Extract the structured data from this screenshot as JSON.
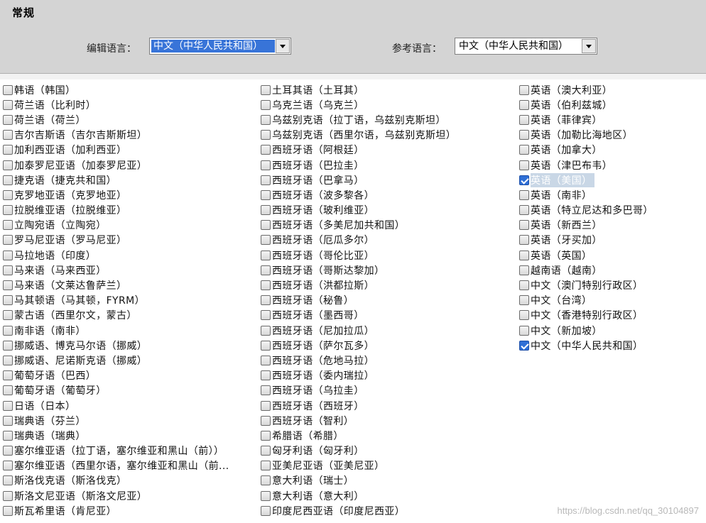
{
  "section": {
    "title": "常规"
  },
  "edit_lang": {
    "label": "编辑语言：",
    "value": "中文（中华人民共和国）"
  },
  "ref_lang": {
    "label": "参考语言：",
    "value": "中文（中华人民共和国）"
  },
  "columns": [
    [
      {
        "label": "韩语（韩国）",
        "checked": false
      },
      {
        "label": "荷兰语（比利时）",
        "checked": false
      },
      {
        "label": "荷兰语（荷兰）",
        "checked": false
      },
      {
        "label": "吉尔吉斯语（吉尔吉斯斯坦）",
        "checked": false
      },
      {
        "label": "加利西亚语（加利西亚）",
        "checked": false
      },
      {
        "label": "加泰罗尼亚语（加泰罗尼亚）",
        "checked": false
      },
      {
        "label": "捷克语（捷克共和国）",
        "checked": false
      },
      {
        "label": "克罗地亚语（克罗地亚）",
        "checked": false
      },
      {
        "label": "拉脱维亚语（拉脱维亚）",
        "checked": false
      },
      {
        "label": "立陶宛语（立陶宛）",
        "checked": false
      },
      {
        "label": "罗马尼亚语（罗马尼亚）",
        "checked": false
      },
      {
        "label": "马拉地语（印度）",
        "checked": false
      },
      {
        "label": "马来语（马来西亚）",
        "checked": false
      },
      {
        "label": "马来语（文莱达鲁萨兰）",
        "checked": false
      },
      {
        "label": "马其顿语（马其顿，FYRM）",
        "checked": false
      },
      {
        "label": "蒙古语（西里尔文，蒙古）",
        "checked": false
      },
      {
        "label": "南非语（南非）",
        "checked": false
      },
      {
        "label": "挪威语、博克马尔语（挪威）",
        "checked": false
      },
      {
        "label": "挪威语、尼诺斯克语（挪威）",
        "checked": false
      },
      {
        "label": "葡萄牙语（巴西）",
        "checked": false
      },
      {
        "label": "葡萄牙语（葡萄牙）",
        "checked": false
      },
      {
        "label": "日语（日本）",
        "checked": false
      },
      {
        "label": "瑞典语（芬兰）",
        "checked": false
      },
      {
        "label": "瑞典语（瑞典）",
        "checked": false
      },
      {
        "label": "塞尔维亚语（拉丁语，塞尔维亚和黑山（前））",
        "checked": false
      },
      {
        "label": "塞尔维亚语（西里尔语，塞尔维亚和黑山（前...",
        "checked": false
      },
      {
        "label": "斯洛伐克语（斯洛伐克）",
        "checked": false
      },
      {
        "label": "斯洛文尼亚语（斯洛文尼亚）",
        "checked": false
      },
      {
        "label": "斯瓦希里语（肯尼亚）",
        "checked": false
      }
    ],
    [
      {
        "label": "土耳其语（土耳其）",
        "checked": false
      },
      {
        "label": "乌克兰语（乌克兰）",
        "checked": false
      },
      {
        "label": "乌兹别克语（拉丁语，乌兹别克斯坦）",
        "checked": false
      },
      {
        "label": "乌兹别克语（西里尔语，乌兹别克斯坦）",
        "checked": false
      },
      {
        "label": "西班牙语（阿根廷）",
        "checked": false
      },
      {
        "label": "西班牙语（巴拉圭）",
        "checked": false
      },
      {
        "label": "西班牙语（巴拿马）",
        "checked": false
      },
      {
        "label": "西班牙语（波多黎各）",
        "checked": false
      },
      {
        "label": "西班牙语（玻利维亚）",
        "checked": false
      },
      {
        "label": "西班牙语（多美尼加共和国）",
        "checked": false
      },
      {
        "label": "西班牙语（厄瓜多尔）",
        "checked": false
      },
      {
        "label": "西班牙语（哥伦比亚）",
        "checked": false
      },
      {
        "label": "西班牙语（哥斯达黎加）",
        "checked": false
      },
      {
        "label": "西班牙语（洪都拉斯）",
        "checked": false
      },
      {
        "label": "西班牙语（秘鲁）",
        "checked": false
      },
      {
        "label": "西班牙语（墨西哥）",
        "checked": false
      },
      {
        "label": "西班牙语（尼加拉瓜）",
        "checked": false
      },
      {
        "label": "西班牙语（萨尔瓦多）",
        "checked": false
      },
      {
        "label": "西班牙语（危地马拉）",
        "checked": false
      },
      {
        "label": "西班牙语（委内瑞拉）",
        "checked": false
      },
      {
        "label": "西班牙语（乌拉圭）",
        "checked": false
      },
      {
        "label": "西班牙语（西班牙）",
        "checked": false
      },
      {
        "label": "西班牙语（智利）",
        "checked": false
      },
      {
        "label": "希腊语（希腊）",
        "checked": false
      },
      {
        "label": "匈牙利语（匈牙利）",
        "checked": false
      },
      {
        "label": "亚美尼亚语（亚美尼亚）",
        "checked": false
      },
      {
        "label": "意大利语（瑞士）",
        "checked": false
      },
      {
        "label": "意大利语（意大利）",
        "checked": false
      },
      {
        "label": "印度尼西亚语（印度尼西亚）",
        "checked": false
      }
    ],
    [
      {
        "label": "英语（澳大利亚）",
        "checked": false
      },
      {
        "label": "英语（伯利兹城）",
        "checked": false
      },
      {
        "label": "英语（菲律宾）",
        "checked": false
      },
      {
        "label": "英语（加勒比海地区）",
        "checked": false
      },
      {
        "label": "英语（加拿大）",
        "checked": false
      },
      {
        "label": "英语（津巴布韦）",
        "checked": false
      },
      {
        "label": "英语（美国）",
        "checked": true,
        "selected": true
      },
      {
        "label": "英语（南非）",
        "checked": false
      },
      {
        "label": "英语（特立尼达和多巴哥）",
        "checked": false
      },
      {
        "label": "英语（新西兰）",
        "checked": false
      },
      {
        "label": "英语（牙买加）",
        "checked": false
      },
      {
        "label": "英语（英国）",
        "checked": false
      },
      {
        "label": "越南语（越南）",
        "checked": false
      },
      {
        "label": "中文（澳门特别行政区）",
        "checked": false
      },
      {
        "label": "中文（台湾）",
        "checked": false
      },
      {
        "label": "中文（香港特别行政区）",
        "checked": false
      },
      {
        "label": "中文（新加坡）",
        "checked": false
      },
      {
        "label": "中文（中华人民共和国）",
        "checked": true
      }
    ]
  ],
  "watermark": "https://blog.csdn.net/qq_30104897",
  "colors": {
    "header_bg": "#d4d4d4",
    "focus_blue": "#3874d8"
  }
}
